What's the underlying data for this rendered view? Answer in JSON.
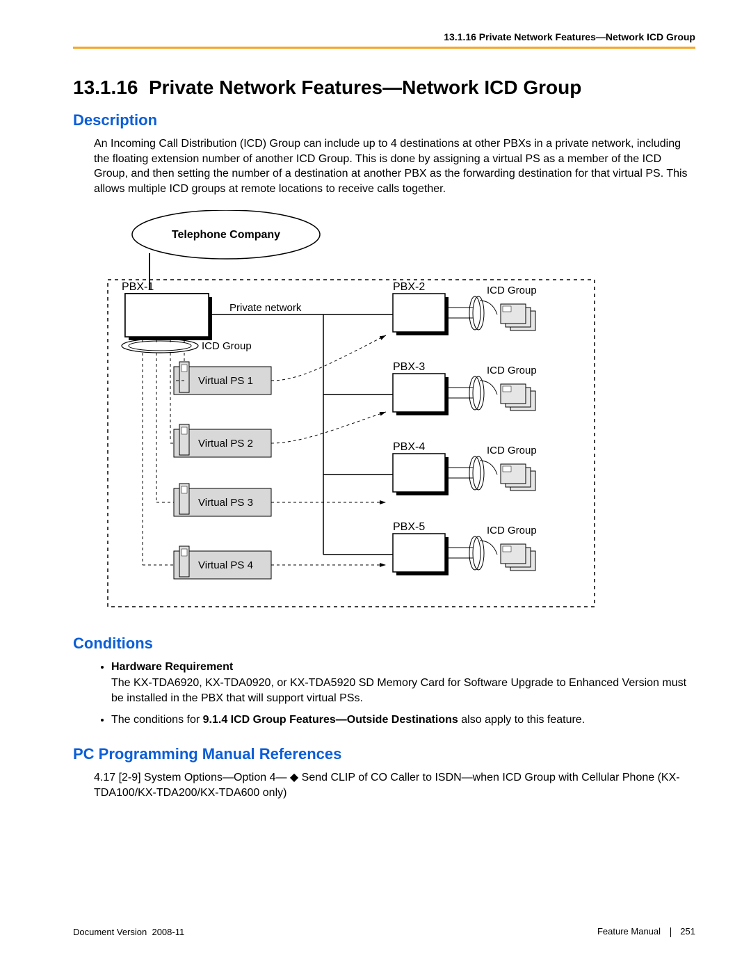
{
  "header": {
    "running": "13.1.16 Private Network Features—Network ICD Group"
  },
  "section": {
    "number": "13.1.16",
    "title": "Private Network Features—Network ICD Group"
  },
  "description": {
    "heading": "Description",
    "text": "An Incoming Call Distribution (ICD) Group can include up to 4 destinations at other PBXs in a private network, including the floating extension number of another ICD Group. This is done by assigning a virtual PS as a member of the ICD Group, and then setting the number of a destination at another PBX as the forwarding destination for that virtual PS. This allows multiple ICD groups at remote locations to receive calls together."
  },
  "diagram": {
    "telco": "Telephone Company",
    "pbx1": "PBX-1",
    "private_network": "Private network",
    "icd_group_label": "ICD Group",
    "virtual_ps": [
      "Virtual PS 1",
      "Virtual PS 2",
      "Virtual PS 3",
      "Virtual PS 4"
    ],
    "remote_pbx": [
      "PBX-2",
      "PBX-3",
      "PBX-4",
      "PBX-5"
    ],
    "icd_group_right": "ICD Group"
  },
  "conditions": {
    "heading": "Conditions",
    "hw_label": "Hardware Requirement",
    "hw_text": "The KX-TDA6920, KX-TDA0920, or KX-TDA5920 SD Memory Card for Software Upgrade to Enhanced Version must be installed in the PBX that will support virtual PSs.",
    "cond2_pre": "The conditions for ",
    "cond2_bold": "9.1.4  ICD Group Features—Outside Destinations",
    "cond2_post": " also apply to this feature."
  },
  "pcref": {
    "heading": "PC Programming Manual References",
    "text": "4.17  [2-9] System Options—Option 4— ◆ Send CLIP of CO Caller to ISDN—when ICD Group with Cellular Phone (KX-TDA100/KX-TDA200/KX-TDA600 only)"
  },
  "footer": {
    "doc_version_label": "Document Version",
    "doc_version": "2008-11",
    "manual": "Feature Manual",
    "page": "251"
  }
}
